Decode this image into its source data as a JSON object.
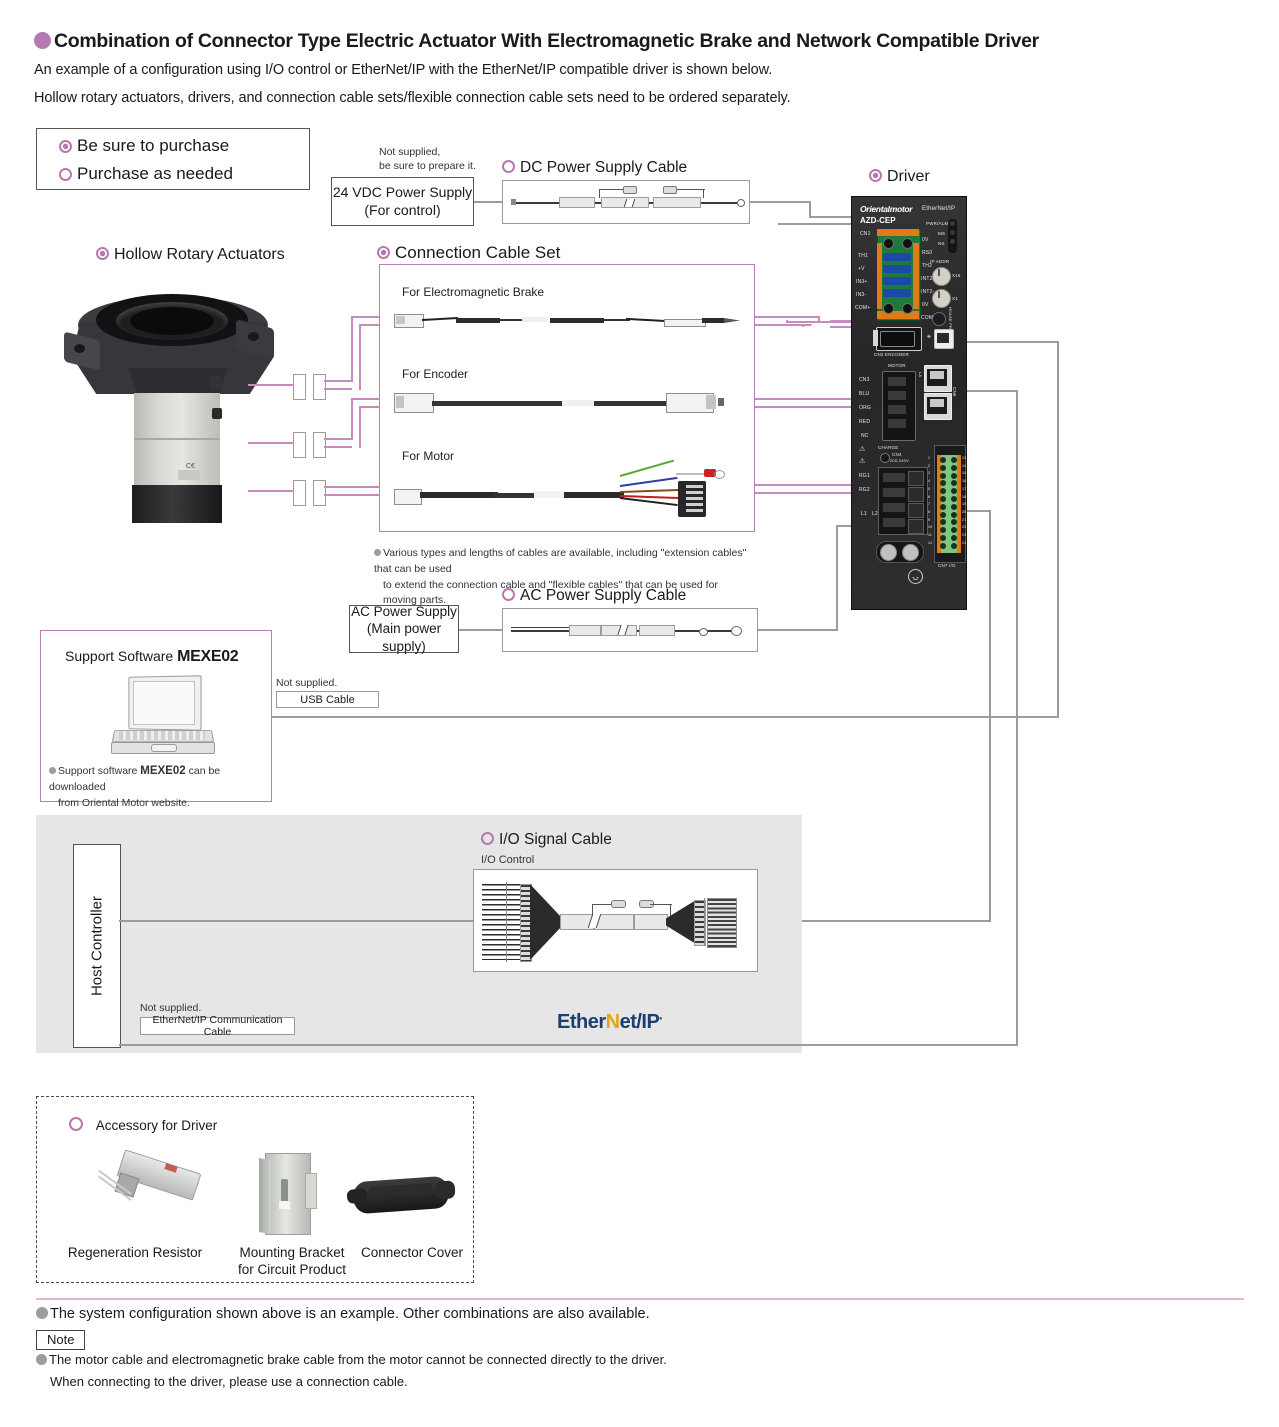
{
  "header": {
    "title": "Combination of Connector Type Electric Actuator With Electromagnetic Brake and Network Compatible Driver",
    "subtitle1": "An example of a configuration using I/O control or EtherNet/IP with the EtherNet/IP compatible driver is shown below.",
    "subtitle2": "Hollow rotary actuators, drivers, and connection cable sets/flexible connection cable sets need to be ordered separately."
  },
  "legend": {
    "must_purchase": "Be sure to purchase",
    "optional_purchase": "Purchase as needed"
  },
  "actuator": {
    "caption": "Hollow Rotary Actuators"
  },
  "dc_supply": {
    "not_supplied_line1": "Not supplied,",
    "not_supplied_line2": "be sure to prepare it.",
    "box_line1": "24 VDC Power Supply",
    "box_line2": "(For control)"
  },
  "dc_cable": {
    "caption": "DC Power Supply Cable"
  },
  "connection_cable_set": {
    "caption": "Connection Cable Set",
    "items": [
      {
        "label": "For Electromagnetic Brake"
      },
      {
        "label": "For Encoder"
      },
      {
        "label": "For Motor"
      }
    ],
    "note_line1": "Various types and lengths of cables are available, including \"extension cables\" that can be used",
    "note_line2": "to extend the connection cable and \"flexible cables\" that can be used for moving parts."
  },
  "ac_supply": {
    "box_line1": "AC Power Supply",
    "box_line2": "(Main power supply)"
  },
  "ac_cable": {
    "caption": "AC Power Supply Cable"
  },
  "driver": {
    "caption": "Driver",
    "brand": "Orientalmotor",
    "network": "EtherNet/IP",
    "model": "AZD-CEP",
    "labels": {
      "cn1": "CN1",
      "left_terminals": [
        "TH1",
        "+V",
        "IN3+",
        "IN3-",
        "COM+"
      ],
      "right_terminals": [
        "0V",
        "RS0",
        "TH2",
        "INT2+",
        "INT2-",
        "0V",
        "COM-"
      ],
      "leds": [
        "PWR/ALM",
        "MS",
        "NS"
      ],
      "ip_addr": "IP ADDR",
      "rotary_x16": "X16",
      "rotary_x1": "X1",
      "hcase": "HCASE PRESET",
      "cn2": "CN2  ENCODER",
      "motor": "MOTOR",
      "motor_terminals": [
        "CN3",
        "BLU",
        "ORG",
        "RED",
        "NC"
      ],
      "lan": "LAN",
      "cn6": "CN6",
      "charge": "CHARGE",
      "cn4": "CN4 200-240V",
      "rg1": "RG1",
      "rg2": "RG2",
      "l1": "L1",
      "l2": "L2",
      "cn7": "CN7 I/O",
      "io_pins_left": [
        "1",
        "2",
        "3",
        "4",
        "5",
        "6",
        "7",
        "8",
        "9",
        "10",
        "11",
        "12"
      ],
      "io_pins_right": [
        "13",
        "14",
        "15",
        "16",
        "17",
        "18",
        "19",
        "20",
        "21",
        "22",
        "23",
        "24"
      ]
    }
  },
  "mexe02": {
    "title_prefix": "Support Software ",
    "title_brand": "MEXE02",
    "note_prefix": "Support software ",
    "note_brand": "MEXE02",
    "note_suffix": " can be downloaded",
    "note_line2": "from Oriental Motor website."
  },
  "usb": {
    "not_supplied": "Not supplied.",
    "label": "USB Cable"
  },
  "io_section": {
    "caption": "I/O Signal Cable",
    "sub_label": "I/O Control",
    "host_controller": "Host Controller",
    "not_supplied": "Not supplied.",
    "comm_cable_label": "EtherNet/IP Communication Cable",
    "logo_part1": "Ether",
    "logo_part2": "N",
    "logo_part3": "et/IP",
    "logo_tm": "•"
  },
  "accessory": {
    "caption": "Accessory for Driver",
    "items": [
      {
        "label_line1": "Regeneration Resistor",
        "label_line2": ""
      },
      {
        "label_line1": "Mounting Bracket",
        "label_line2": "for Circuit Product"
      },
      {
        "label_line1": "Connector Cover",
        "label_line2": ""
      }
    ]
  },
  "footer": {
    "note_main": "The system configuration shown above is an example. Other combinations are also available.",
    "note_tag": "Note",
    "note_line1": "The motor cable and electromagnetic brake cable from the motor cannot be connected directly to the driver.",
    "note_line2": "When connecting to the driver, please use a connection cable."
  },
  "colors": {
    "accent_purple": "#b579b0",
    "line_gray": "#9c9c9c",
    "line_purple": "#c68cc1",
    "panel_gray": "#e6e6e6",
    "brand_blue": "#1c3f70",
    "brand_yellow": "#e8a317"
  }
}
